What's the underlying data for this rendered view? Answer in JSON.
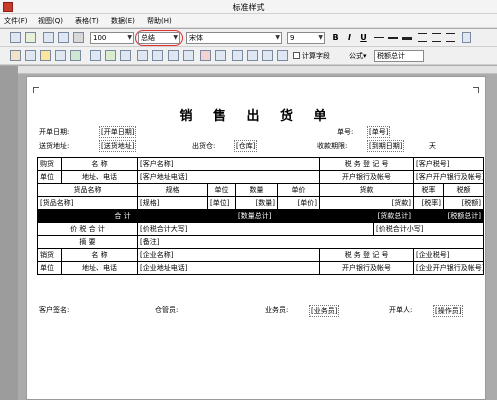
{
  "window": {
    "title": "标准样式"
  },
  "menu": {
    "items": [
      "文件(F)",
      "视图(Q)",
      "表格(T)",
      "数据(E)",
      "帮助(H)"
    ]
  },
  "toolbar1": {
    "zoom": "100",
    "style_name": "总结",
    "font_name": "宋体",
    "font_size": "9",
    "bold": "B",
    "italic": "I",
    "underline": "U"
  },
  "toolbar2": {
    "calc_checkbox_label": "计算字段",
    "formula_label": "公式▾",
    "formula_value": "税额总计"
  },
  "doc": {
    "title": "销 售 出 货 单",
    "open_date_label": "开单日期:",
    "open_date_value": "[开单日期]",
    "no_label": "单号:",
    "no_value": "[单号]",
    "ship_addr_label": "送货地址:",
    "ship_addr_value": "[送货地址]",
    "warehouse_label": "出货仓:",
    "warehouse_value": "[仓库]",
    "term_label": "收款期限:",
    "term_value": "[到期日期]",
    "term_unit": "天",
    "buyer_label": "购货",
    "buyer_name_label": "名   称",
    "buyer_name_value": "[客户名称]",
    "buyer_tax_label": "税 务 登 记 号",
    "buyer_tax_value": "[客户税号]",
    "buyer_unit_label": "单位",
    "buyer_addr_label": "地址、电话",
    "buyer_addr_value": "[客户地址电话]",
    "buyer_bank_label": "开户银行及帐号",
    "buyer_bank_value": "[客户开户银行及帐号]",
    "item_headers": [
      "货品名称",
      "规格",
      "单位",
      "数量",
      "单价",
      "货款",
      "税率",
      "税额"
    ],
    "item_fields": [
      "[货品名称]",
      "[规格]",
      "[单位]",
      "[数量]",
      "[单价]",
      "[货款]",
      "[税率]",
      "[税额]"
    ],
    "total_label": "合      计",
    "total_qty": "[数量总计]",
    "total_amount": "[货款总计]",
    "total_tax": "[税额总计]",
    "price_tax_label": "价 税 合 计",
    "price_tax_upper": "[价税合计大写]",
    "price_tax_lower": "[价税合计小写]",
    "memo_label": "摘      要",
    "memo_value": "[备注]",
    "seller_label": "销货",
    "seller_name_label": "名   称",
    "seller_name_value": "[企业名称]",
    "seller_tax_label": "税 务 登 记 号",
    "seller_tax_value": "[企业税号]",
    "seller_unit_label": "单位",
    "seller_addr_label": "地址、电话",
    "seller_addr_value": "[企业地址电话]",
    "seller_bank_label": "开户银行及帐号",
    "seller_bank_value": "[企业开户银行及帐号]",
    "sign_customer_label": "客户签名:",
    "sign_keeper_label": "仓管员:",
    "sign_sales_label": "业务员:",
    "sign_sales_value": "[业务员]",
    "sign_maker_label": "开单人:",
    "sign_maker_value": "[操作员]"
  }
}
